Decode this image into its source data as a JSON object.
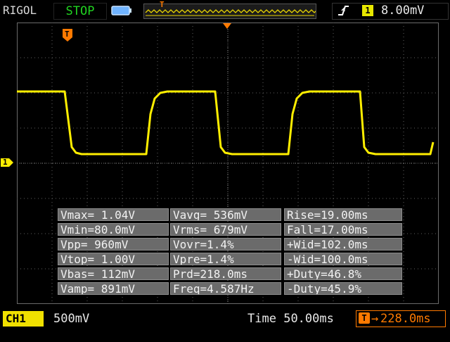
{
  "header": {
    "brand": "RIGOL",
    "run_state": "STOP",
    "trigger_channel": "1",
    "trigger_level": "8.00mV"
  },
  "channel": {
    "label": "CH1",
    "scale": "500mV",
    "marker": "1"
  },
  "timebase": {
    "label": "Time",
    "value": "50.00ms"
  },
  "horizontal_position": {
    "arrow": "→",
    "value": "228.0ms"
  },
  "trigger_marker": "T",
  "measurements": [
    [
      "Vmax= 1.04V",
      "Vavg= 536mV",
      "Rise=19.00ms"
    ],
    [
      "Vmin=80.0mV",
      "Vrms= 679mV",
      "Fall=17.00ms"
    ],
    [
      "Vpp= 960mV",
      "Vovr=1.4%",
      "+Wid=102.0ms"
    ],
    [
      "Vtop= 1.00V",
      "Vpre=1.4%",
      "-Wid=100.0ms"
    ],
    [
      "Vbas= 112mV",
      "Prd=218.0ms",
      "+Duty=46.8%"
    ],
    [
      "Vamp= 891mV",
      "Freq=4.587Hz",
      "-Duty=45.9%"
    ]
  ],
  "colors": {
    "trace": "#ffee00",
    "grid_dot": "#6a6a6a",
    "accent_orange": "#ff7a00",
    "run_state_green": "#21d321"
  },
  "icons": {
    "battery": "battery-icon",
    "trigger_edge": "rising-edge-icon"
  }
}
